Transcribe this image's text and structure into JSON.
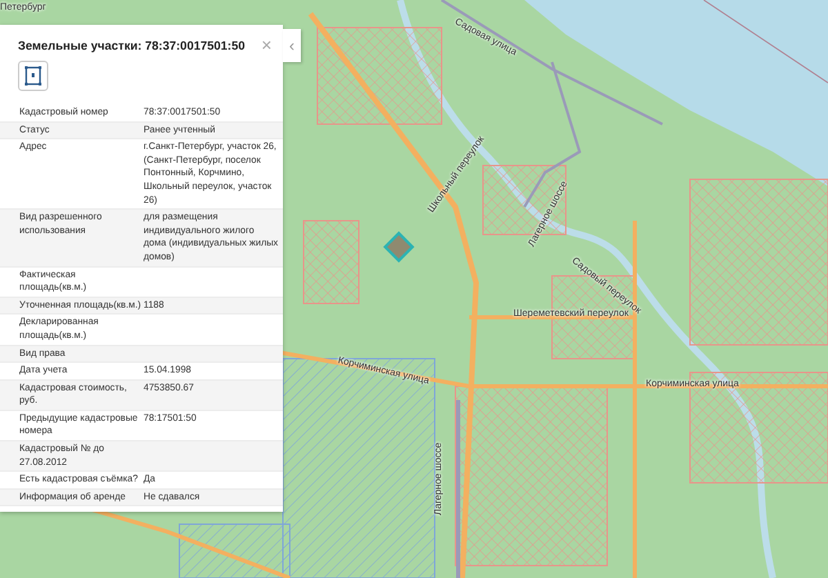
{
  "map": {
    "labels": [
      "Петербург",
      "Садовая улица",
      "Школьный переулок",
      "Лагерное шоссе",
      "Садовый переулок",
      "Шереметевский переулок",
      "Корчиминская улица",
      "Корчиминская улица",
      "Лагерное шоссе"
    ]
  },
  "panel": {
    "title": "Земельные участки: 78:37:0017501:50",
    "close": "×",
    "toggle": "‹",
    "rows": [
      {
        "label": "Кадастровый номер",
        "value": "78:37:0017501:50"
      },
      {
        "label": "Статус",
        "value": "Ранее учтенный"
      },
      {
        "label": "Адрес",
        "value": "г.Санкт-Петербург, участок 26, (Санкт-Петербург, поселок Понтонный, Корчмино, Школьный переулок, участок 26)"
      },
      {
        "label": "Вид разрешенного использования",
        "value": "для размещения индивидуального жилого дома (индивидуальных жилых домов)"
      },
      {
        "label": "Фактическая площадь(кв.м.)"
      },
      {
        "label": "Уточненная площадь(кв.м.)",
        "value": "1188"
      },
      {
        "label": "Декларированная площадь(кв.м.)"
      },
      {
        "label": "Вид права"
      },
      {
        "label": "Дата учета",
        "value": "15.04.1998"
      },
      {
        "label": "Кадастровая стоимость, руб.",
        "value": "4753850.67"
      },
      {
        "label": "Предыдущие кадастровые номера",
        "value": "78:17501:50"
      },
      {
        "label": "Кадастровый № до 27.08.2012"
      },
      {
        "label": "Есть кадастровая съёмка?",
        "value": "Да"
      },
      {
        "label": "Информация об аренде",
        "value": "Не сдавался"
      }
    ]
  }
}
